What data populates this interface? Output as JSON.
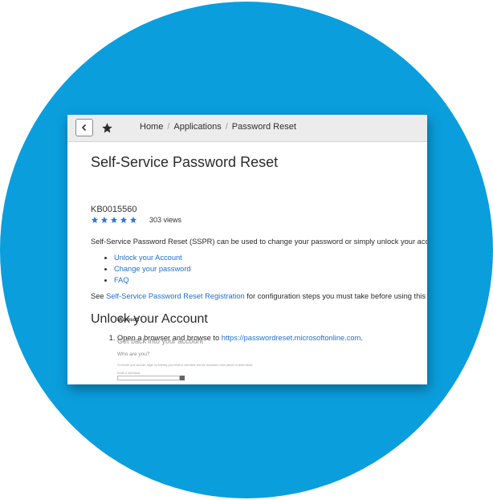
{
  "colors": {
    "circle": "#0a9edd",
    "link": "#1f6fd0",
    "star": "#2f79d9"
  },
  "toolbar": {
    "back_icon": "chevron-left-icon",
    "favorite_icon": "star-icon"
  },
  "breadcrumb": [
    "Home",
    "Applications",
    "Password Reset"
  ],
  "article": {
    "title": "Self-Service Password Reset",
    "kb_number": "KB0015560",
    "rating": 5,
    "views": "303 views",
    "intro": "Self-Service Password Reset (SSPR) can be used to change your password or simply unlock your account.",
    "links": [
      "Unlock your Account",
      "Change your password",
      "FAQ"
    ],
    "see_prefix": "See ",
    "see_link": "Self-Service Password Reset Registration",
    "see_suffix": " for configuration steps you must take before using this tool.",
    "section_title": "Unlock your Account",
    "step1_prefix": "Open a browser and browse to ",
    "step1_link": "https://passwordreset.microsoftonline.com",
    "step1_suffix": "."
  },
  "ms_screenshot": {
    "brand": "Microsoft",
    "heading": "Get back into your account",
    "subheading": "Who are you?",
    "description": "To recover your account, begin by entering your email or username and the characters in the picture or audio below.",
    "field_label": "Email or Username:"
  }
}
